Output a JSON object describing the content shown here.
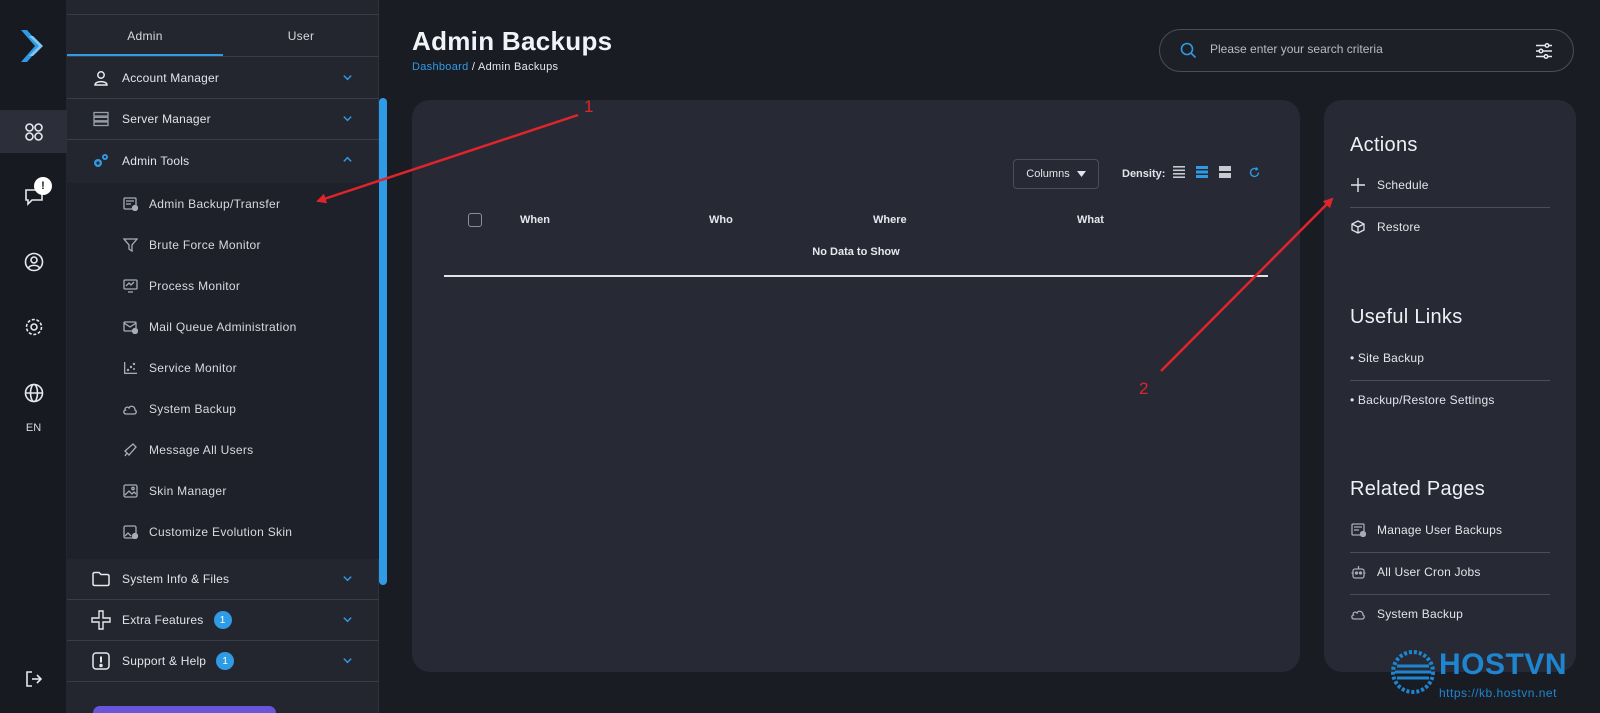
{
  "rail": {
    "items": [
      {
        "icon": "dashboard-grid-icon",
        "active": true
      },
      {
        "icon": "message-icon",
        "badge": "!"
      },
      {
        "icon": "user-circle-icon"
      },
      {
        "icon": "gear-icon"
      },
      {
        "icon": "globe-icon"
      }
    ],
    "language": "EN",
    "logout_icon": "logout-icon"
  },
  "sidebar": {
    "tabs": [
      {
        "label": "Admin",
        "active": true
      },
      {
        "label": "User",
        "active": false
      }
    ],
    "sections": [
      {
        "label": "Account Manager",
        "icon": "user-icon",
        "expanded": false
      },
      {
        "label": "Server Manager",
        "icon": "server-icon",
        "expanded": false
      },
      {
        "label": "Admin Tools",
        "icon": "gears-icon",
        "expanded": true
      },
      {
        "label": "System Info & Files",
        "icon": "folder-icon",
        "expanded": false
      },
      {
        "label": "Extra Features",
        "icon": "plus-icon",
        "expanded": false,
        "badge": "1"
      },
      {
        "label": "Support & Help",
        "icon": "alert-box-icon",
        "expanded": false,
        "badge": "1"
      }
    ],
    "admin_tools_items": [
      {
        "label": "Admin Backup/Transfer",
        "icon": "backup-icon"
      },
      {
        "label": "Brute Force Monitor",
        "icon": "filter-icon"
      },
      {
        "label": "Process Monitor",
        "icon": "monitor-icon"
      },
      {
        "label": "Mail Queue Administration",
        "icon": "mail-icon"
      },
      {
        "label": "Service Monitor",
        "icon": "service-icon"
      },
      {
        "label": "System Backup",
        "icon": "cloud-icon"
      },
      {
        "label": "Message All Users",
        "icon": "megaphone-icon"
      },
      {
        "label": "Skin Manager",
        "icon": "image-icon"
      },
      {
        "label": "Customize Evolution Skin",
        "icon": "image-edit-icon"
      }
    ]
  },
  "header": {
    "title": "Admin Backups",
    "breadcrumb_link": "Dashboard",
    "breadcrumb_sep": " / ",
    "breadcrumb_current": "Admin Backups"
  },
  "search": {
    "placeholder": "Please enter your search criteria",
    "value": ""
  },
  "table": {
    "columns_button": "Columns",
    "density_label": "Density:",
    "headers": [
      "When",
      "Who",
      "Where",
      "What"
    ],
    "empty_text": "No Data to Show"
  },
  "right_panel": {
    "actions_title": "Actions",
    "actions": [
      {
        "label": "Schedule",
        "icon": "plus-icon"
      },
      {
        "label": "Restore",
        "icon": "box-icon"
      }
    ],
    "links_title": "Useful Links",
    "links": [
      {
        "label": "• Site Backup"
      },
      {
        "label": "• Backup/Restore Settings"
      }
    ],
    "related_title": "Related Pages",
    "related": [
      {
        "label": "Manage User Backups",
        "icon": "backup-icon"
      },
      {
        "label": "All User Cron Jobs",
        "icon": "robot-icon"
      },
      {
        "label": "System Backup",
        "icon": "cloud-icon"
      }
    ]
  },
  "annotations": {
    "arrow_1_label": "1",
    "arrow_2_label": "2",
    "color": "#e0242c"
  },
  "watermark": {
    "brand": "HOSTVN",
    "url": "https://kb.hostvn.net"
  },
  "colors": {
    "accent": "#2f9be5",
    "background": "#1a1c24",
    "panel": "#272a34",
    "sidebar": "#23262f"
  }
}
